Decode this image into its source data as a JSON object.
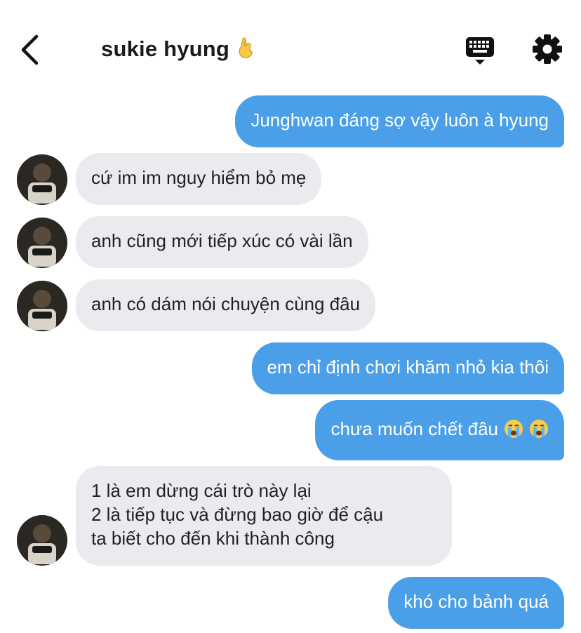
{
  "header": {
    "back_icon": "chevron-left-icon",
    "contact_name": "sukie hyung",
    "name_emoji_icon": "crossed-fingers-emoji-icon",
    "keyboard_icon": "keyboard-icon",
    "settings_icon": "gear-icon"
  },
  "messages": [
    {
      "side": "out",
      "text": "Junghwan đáng sợ vậy luôn à hyung"
    },
    {
      "side": "in",
      "text": "cứ im im nguy hiểm bỏ mẹ"
    },
    {
      "side": "in",
      "text": "anh cũng mới tiếp xúc có vài lần"
    },
    {
      "side": "in",
      "text": "anh có dám nói chuyện cùng đâu"
    },
    {
      "side": "out",
      "text": "em chỉ định chơi khăm nhỏ kia thôi"
    },
    {
      "side": "out",
      "text": "chưa muốn chết đâu",
      "emoji": [
        "crying-face-emoji-icon",
        "crying-face-emoji-icon"
      ]
    },
    {
      "side": "in",
      "lines": [
        "1 là em dừng cái trò này lại",
        "2 là tiếp tục và đừng bao giờ để cậu",
        "ta biết cho đến khi thành công"
      ]
    },
    {
      "side": "out",
      "text": "khó cho bảnh quá"
    }
  ],
  "colors": {
    "outgoing_bubble": "#4a9fe8",
    "incoming_bubble": "#e9ebee",
    "outgoing_text": "#ffffff",
    "incoming_text": "#222222"
  }
}
